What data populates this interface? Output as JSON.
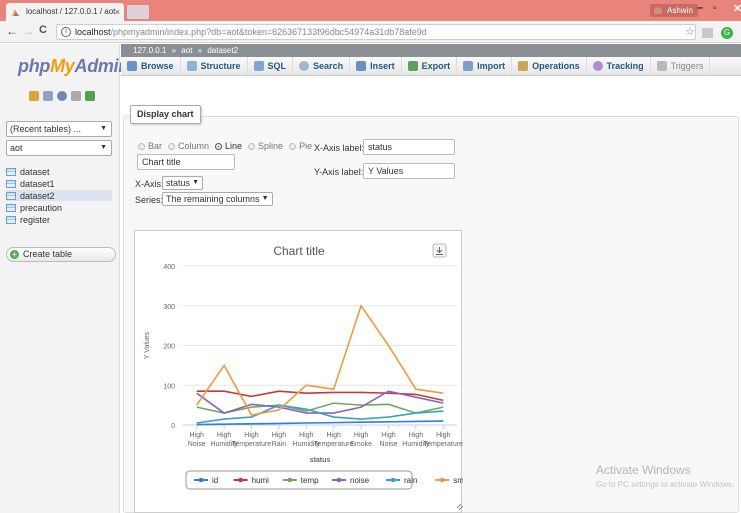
{
  "browser": {
    "tab_title": "localhost / 127.0.0.1 / aot",
    "tab_close": "×",
    "profile_name": "Ashwin",
    "url_host": "localhost",
    "url_path": "/phpmyadmin/index.php?db=aot&token=626367133f96dbc54974a31db78afe9d",
    "back": "←",
    "forward": "→",
    "reload": "C",
    "star": "☆",
    "min": "–",
    "max": "▫",
    "close": "✕"
  },
  "sidebar": {
    "logo_php": "php",
    "logo_my": "My",
    "logo_admin": "Admin",
    "recent_tables": "(Recent tables) ...",
    "database": "aot",
    "tables": [
      "dataset",
      "dataset1",
      "dataset2",
      "precaution",
      "register"
    ],
    "create_table": "Create table"
  },
  "breadcrumb": {
    "server": "127.0.0.1",
    "database": "aot",
    "table": "dataset2",
    "sep": "»"
  },
  "tabs": [
    {
      "label": "Browse",
      "icon": "browse-icon",
      "color": "#6a93c8"
    },
    {
      "label": "Structure",
      "icon": "structure-icon",
      "color": "#8fb0d8"
    },
    {
      "label": "SQL",
      "icon": "sql-icon",
      "color": "#7fa6d6"
    },
    {
      "label": "Search",
      "icon": "search-icon",
      "color": "#a5b7cc"
    },
    {
      "label": "Insert",
      "icon": "insert-icon",
      "color": "#6b8fbf"
    },
    {
      "label": "Export",
      "icon": "export-icon",
      "color": "#5f9f5f"
    },
    {
      "label": "Import",
      "icon": "import-icon",
      "color": "#7e9fcc"
    },
    {
      "label": "Operations",
      "icon": "wrench-icon",
      "color": "#c9a55a"
    },
    {
      "label": "Tracking",
      "icon": "tracking-icon",
      "color": "#b48bd0"
    },
    {
      "label": "Triggers",
      "icon": "triggers-icon",
      "color": "#b9b9b9"
    }
  ],
  "form": {
    "legend": "Display chart",
    "chart_types": [
      {
        "label": "Bar",
        "selected": false
      },
      {
        "label": "Column",
        "selected": false
      },
      {
        "label": "Line",
        "selected": true
      },
      {
        "label": "Spline",
        "selected": false
      },
      {
        "label": "Pie",
        "selected": false
      }
    ],
    "chart_title_value": "Chart title",
    "xaxis_label_caption": "X-Axis label:",
    "xaxis_label_value": "status",
    "yaxis_label_caption": "Y-Axis label:",
    "yaxis_label_value": "Y Values",
    "xaxis_caption": "X-Axis:",
    "xaxis_value": "status",
    "series_caption": "Series:",
    "series_value": "The remaining columns"
  },
  "chart_data": {
    "type": "line",
    "title": "Chart title",
    "xlabel": "status",
    "ylabel": "Y Values",
    "ylim": [
      0,
      400
    ],
    "yticks": [
      0,
      100,
      200,
      300,
      400
    ],
    "categories": [
      [
        "High",
        "Noise"
      ],
      [
        "High",
        "Humidity"
      ],
      [
        "High",
        "Temperature"
      ],
      [
        "High",
        "Rain"
      ],
      [
        "High",
        "Humidity"
      ],
      [
        "High",
        "Temperature"
      ],
      [
        "High",
        "Smoke"
      ],
      [
        "High",
        "Noise"
      ],
      [
        "High",
        "Humidity"
      ],
      [
        "High",
        "Temperature"
      ]
    ],
    "series": [
      {
        "name": "id",
        "color": "#2f7ed8",
        "values": [
          1,
          2,
          3,
          4,
          5,
          6,
          7,
          8,
          9,
          10
        ]
      },
      {
        "name": "humi",
        "color": "#c23b3b",
        "values": [
          85,
          85,
          72,
          85,
          80,
          82,
          82,
          80,
          77,
          62
        ]
      },
      {
        "name": "temp",
        "color": "#6aaa5e",
        "values": [
          45,
          30,
          45,
          50,
          35,
          55,
          50,
          52,
          30,
          45
        ]
      },
      {
        "name": "noise",
        "color": "#8b65b5",
        "values": [
          80,
          30,
          52,
          45,
          30,
          30,
          45,
          85,
          70,
          55
        ]
      },
      {
        "name": "rain",
        "color": "#3aa0c8",
        "values": [
          5,
          15,
          20,
          50,
          40,
          20,
          15,
          20,
          30,
          35
        ]
      },
      {
        "name": "smoke",
        "color": "#f09a3e",
        "values": [
          50,
          150,
          25,
          38,
          100,
          90,
          300,
          200,
          90,
          80
        ]
      }
    ],
    "legend_placement": "bottom",
    "export_icon": "download-icon"
  },
  "watermark": {
    "line1": "Activate Windows",
    "line2": "Go to PC settings to activate Windows."
  }
}
